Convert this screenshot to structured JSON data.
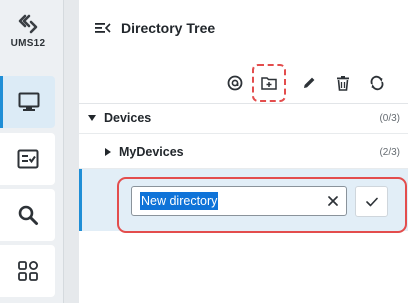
{
  "app": {
    "logo_text": "UMS12"
  },
  "sidebar": {
    "items": [
      {
        "name": "devices",
        "icon": "monitor-icon",
        "active": true
      },
      {
        "name": "profiles",
        "icon": "checklist-icon",
        "active": false
      },
      {
        "name": "search",
        "icon": "search-icon",
        "active": false
      },
      {
        "name": "apps",
        "icon": "grid-icon",
        "active": false
      }
    ]
  },
  "panel": {
    "title": "Directory Tree",
    "toolbar": [
      {
        "name": "at-sign",
        "icon": "at-icon"
      },
      {
        "name": "new-directory",
        "icon": "folder-plus-icon"
      },
      {
        "name": "edit",
        "icon": "pencil-icon"
      },
      {
        "name": "delete",
        "icon": "trash-icon"
      },
      {
        "name": "refresh",
        "icon": "refresh-icon"
      }
    ]
  },
  "tree": {
    "root": {
      "label": "Devices",
      "count": "(0/3)"
    },
    "child": {
      "label": "MyDevices",
      "count": "(2/3)"
    },
    "new_dir": {
      "value": "New directory"
    }
  },
  "colors": {
    "accent": "#1f8ed6",
    "highlight": "#e34d4d",
    "selection": "#0f73d8"
  }
}
